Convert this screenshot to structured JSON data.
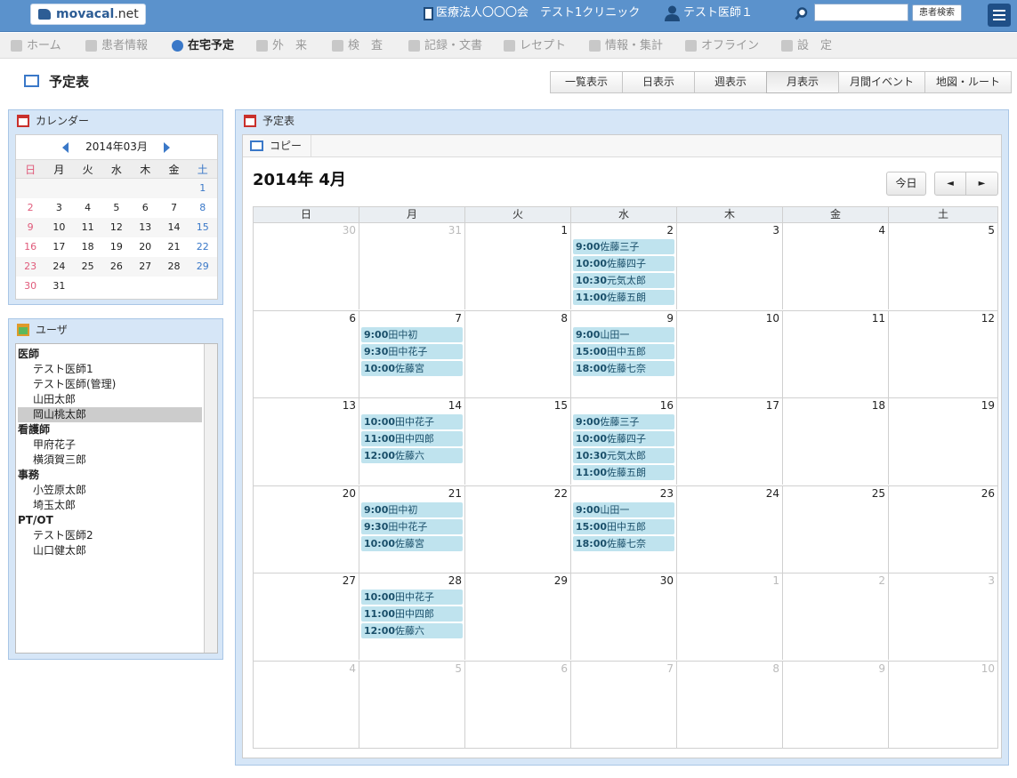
{
  "header": {
    "logo": {
      "brand": "movacal",
      "suffix": ".net"
    },
    "organization": "医療法人〇〇〇会　テスト1クリニック",
    "doctor": "テスト医師１",
    "search": {
      "placeholder": "",
      "value": "",
      "button_label": "患者検索"
    }
  },
  "nav": [
    {
      "label": "ホーム",
      "icon": "home-icon"
    },
    {
      "label": "患者情報",
      "icon": "patients-icon"
    },
    {
      "label": "在宅予定",
      "icon": "clock-icon",
      "active": true
    },
    {
      "label": "外　来",
      "icon": "outpatient-icon"
    },
    {
      "label": "検　査",
      "icon": "exam-icon"
    },
    {
      "label": "記録・文書",
      "icon": "document-icon"
    },
    {
      "label": "レセプト",
      "icon": "receipt-icon"
    },
    {
      "label": "情報・集計",
      "icon": "monitor-icon"
    },
    {
      "label": "オフライン",
      "icon": "offline-icon"
    },
    {
      "label": "設　定",
      "icon": "settings-icon"
    }
  ],
  "page_title": "予定表",
  "view_tabs": [
    {
      "label": "一覧表示"
    },
    {
      "label": "日表示"
    },
    {
      "label": "週表示"
    },
    {
      "label": "月表示",
      "active": true
    },
    {
      "label": "月間イベント"
    },
    {
      "label": "地図・ルート"
    }
  ],
  "calendar_panel": {
    "title": "カレンダー",
    "month_label": "2014年03月",
    "weekdays": [
      "日",
      "月",
      "火",
      "水",
      "木",
      "金",
      "土"
    ],
    "today": "14",
    "weeks": [
      [
        "",
        "",
        "",
        "",
        "",
        "",
        "1"
      ],
      [
        "2",
        "3",
        "4",
        "5",
        "6",
        "7",
        "8"
      ],
      [
        "9",
        "10",
        "11",
        "12",
        "13",
        "14",
        "15"
      ],
      [
        "16",
        "17",
        "18",
        "19",
        "20",
        "21",
        "22"
      ],
      [
        "23",
        "24",
        "25",
        "26",
        "27",
        "28",
        "29"
      ],
      [
        "30",
        "31",
        "",
        "",
        "",
        "",
        ""
      ]
    ]
  },
  "user_panel": {
    "title": "ユーザ",
    "groups": [
      {
        "name": "医師",
        "users": [
          "テスト医師1",
          "テスト医師(管理)",
          "山田太郎",
          "岡山桃太郎"
        ]
      },
      {
        "name": "看護師",
        "users": [
          "甲府花子",
          "横須賀三郎"
        ]
      },
      {
        "name": "事務",
        "users": [
          "小笠原太郎",
          "埼玉太郎"
        ]
      },
      {
        "name": "PT/OT",
        "users": [
          "テスト医師2",
          "山口健太郎"
        ]
      }
    ],
    "selected": "岡山桃太郎"
  },
  "schedule_panel": {
    "title": "予定表",
    "copy_label": "コピー",
    "month_title": "2014年 4月",
    "today_label": "今日",
    "prev_label": "◄",
    "next_label": "►",
    "weekdays": [
      "日",
      "月",
      "火",
      "水",
      "木",
      "金",
      "土"
    ],
    "weeks": [
      [
        {
          "d": "30",
          "other": true
        },
        {
          "d": "31",
          "other": true
        },
        {
          "d": "1"
        },
        {
          "d": "2",
          "events": [
            [
              "9:00",
              "佐藤三子"
            ],
            [
              "10:00",
              "佐藤四子"
            ],
            [
              "10:30",
              "元気太郎"
            ],
            [
              "11:00",
              "佐藤五朗"
            ]
          ]
        },
        {
          "d": "3"
        },
        {
          "d": "4"
        },
        {
          "d": "5"
        }
      ],
      [
        {
          "d": "6"
        },
        {
          "d": "7",
          "events": [
            [
              "9:00",
              "田中初"
            ],
            [
              "9:30",
              "田中花子"
            ],
            [
              "10:00",
              "佐藤宮"
            ]
          ]
        },
        {
          "d": "8"
        },
        {
          "d": "9",
          "events": [
            [
              "9:00",
              "山田一"
            ],
            [
              "15:00",
              "田中五郎"
            ],
            [
              "18:00",
              "佐藤七奈"
            ]
          ]
        },
        {
          "d": "10"
        },
        {
          "d": "11"
        },
        {
          "d": "12"
        }
      ],
      [
        {
          "d": "13"
        },
        {
          "d": "14",
          "events": [
            [
              "10:00",
              "田中花子"
            ],
            [
              "11:00",
              "田中四郎"
            ],
            [
              "12:00",
              "佐藤六"
            ]
          ]
        },
        {
          "d": "15"
        },
        {
          "d": "16",
          "events": [
            [
              "9:00",
              "佐藤三子"
            ],
            [
              "10:00",
              "佐藤四子"
            ],
            [
              "10:30",
              "元気太郎"
            ],
            [
              "11:00",
              "佐藤五朗"
            ]
          ]
        },
        {
          "d": "17"
        },
        {
          "d": "18"
        },
        {
          "d": "19"
        }
      ],
      [
        {
          "d": "20"
        },
        {
          "d": "21",
          "events": [
            [
              "9:00",
              "田中初"
            ],
            [
              "9:30",
              "田中花子"
            ],
            [
              "10:00",
              "佐藤宮"
            ]
          ]
        },
        {
          "d": "22"
        },
        {
          "d": "23",
          "events": [
            [
              "9:00",
              "山田一"
            ],
            [
              "15:00",
              "田中五郎"
            ],
            [
              "18:00",
              "佐藤七奈"
            ]
          ]
        },
        {
          "d": "24"
        },
        {
          "d": "25"
        },
        {
          "d": "26"
        }
      ],
      [
        {
          "d": "27"
        },
        {
          "d": "28",
          "events": [
            [
              "10:00",
              "田中花子"
            ],
            [
              "11:00",
              "田中四郎"
            ],
            [
              "12:00",
              "佐藤六"
            ]
          ]
        },
        {
          "d": "29"
        },
        {
          "d": "30"
        },
        {
          "d": "1",
          "other": true
        },
        {
          "d": "2",
          "other": true
        },
        {
          "d": "3",
          "other": true
        }
      ],
      [
        {
          "d": "4",
          "other": true
        },
        {
          "d": "5",
          "other": true
        },
        {
          "d": "6",
          "other": true
        },
        {
          "d": "7",
          "other": true
        },
        {
          "d": "8",
          "other": true
        },
        {
          "d": "9",
          "other": true
        },
        {
          "d": "10",
          "other": true
        }
      ]
    ]
  },
  "colors": {
    "header_bg": "#5b92cc",
    "panel_bg": "#d6e6f7",
    "event_bg": "#bfe3ee",
    "today_bg": "#fbd5ea",
    "accent": "#3a78c8"
  }
}
